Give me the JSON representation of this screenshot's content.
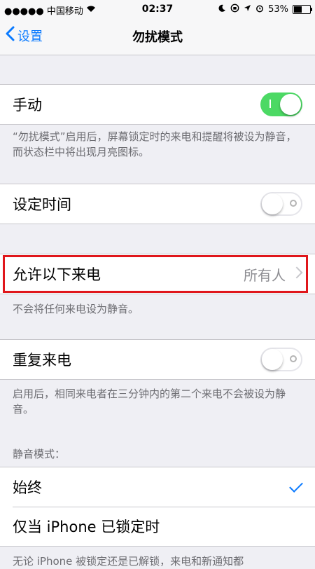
{
  "status": {
    "carrier": "●●●●● 中国移动",
    "time": "02:37",
    "battery": "53%",
    "battery_level": 0.53
  },
  "nav": {
    "back_label": "设置",
    "title": "勿扰模式"
  },
  "manual": {
    "label": "手动",
    "enabled": true,
    "note": "“勿扰模式”启用后，屏幕锁定时的来电和提醒将被设为静音，而状态栏中将出现月亮图标。"
  },
  "scheduled": {
    "label": "设定时间",
    "enabled": false
  },
  "allow_calls": {
    "label": "允许以下来电",
    "value": "所有人",
    "note": "不会将任何来电设为静音。"
  },
  "repeated_calls": {
    "label": "重复来电",
    "enabled": false,
    "note": "启用后，相同来电者在三分钟内的第二个来电不会被设为静音。"
  },
  "silence": {
    "header": "静音模式：",
    "options": [
      "始终",
      "仅当 iPhone 已锁定时"
    ],
    "selected_index": 0,
    "footer_partial": "无论 iPhone 被锁定还是已解锁，来电和新通知都"
  },
  "colors": {
    "accent": "#0a7aff",
    "toggle_on": "#4cd964",
    "highlight": "#e0161b"
  }
}
